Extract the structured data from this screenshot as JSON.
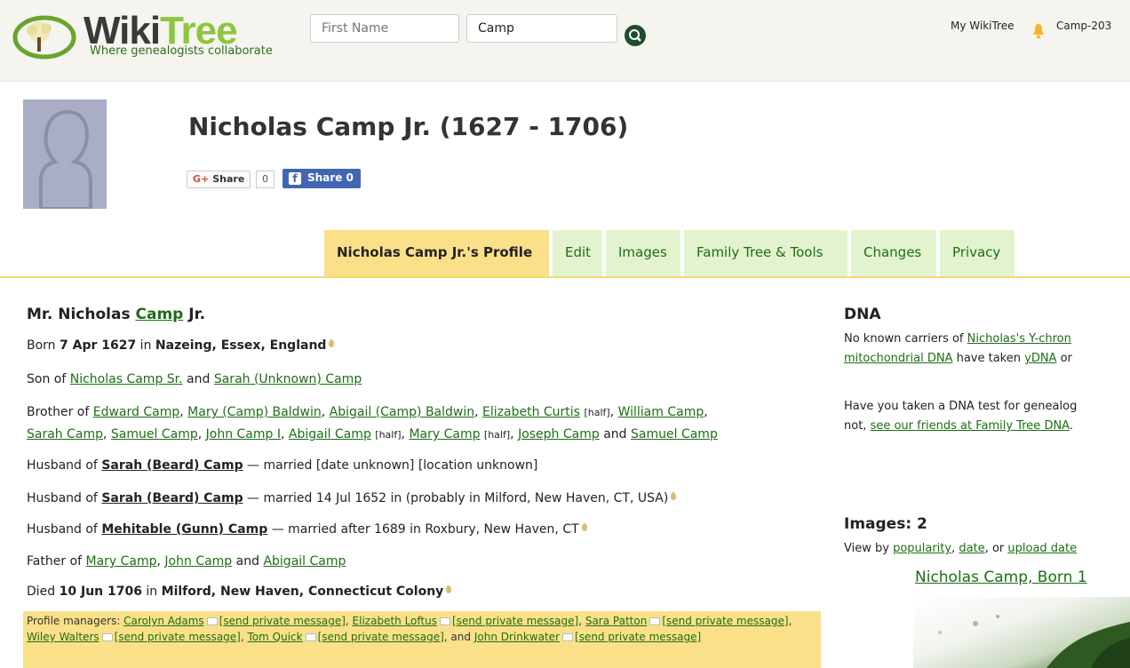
{
  "header": {
    "logo_word1": "Wiki",
    "logo_word2": "Tree",
    "tagline": "Where genealogists collaborate",
    "first_name_placeholder": "First Name",
    "last_name_value": "Camp",
    "my_wikitree": "My WikiTree",
    "user_id": "Camp-203"
  },
  "profile": {
    "title": "Nicholas Camp Jr. (1627 - 1706)",
    "gplus_label": "Share",
    "gplus_count": "0",
    "fb_label": "Share 0"
  },
  "tabs": [
    {
      "label": "Nicholas Camp Jr.'s Profile"
    },
    {
      "label": "Edit"
    },
    {
      "label": "Images"
    },
    {
      "label": "Family Tree & Tools"
    },
    {
      "label": "Changes"
    },
    {
      "label": "Privacy"
    }
  ],
  "bio": {
    "name_prefix": "Mr. Nicholas ",
    "surname": "Camp",
    "name_suffix": " Jr.",
    "born_label": "Born ",
    "born_date": "7 Apr 1627",
    "born_in": " in ",
    "born_place": "Nazeing, Essex, England",
    "son_of": "Son of ",
    "father": "Nicholas Camp Sr.",
    "and": " and ",
    "mother": "Sarah (Unknown) Camp",
    "brother_of": "Brother of ",
    "siblings_line1": [
      "Edward Camp",
      "Mary (Camp) Baldwin",
      "Abigail (Camp) Baldwin",
      "Elizabeth Curtis",
      "William Camp"
    ],
    "siblings_line2": [
      "Sarah Camp",
      "Samuel Camp",
      "John Camp I",
      "Abigail Camp",
      "Mary Camp",
      "Joseph Camp",
      "Samuel Camp"
    ],
    "half": "[half]",
    "husband_of": "Husband of ",
    "spouse1": "Sarah (Beard) Camp",
    "marriage1": " — married [date unknown] [location unknown]",
    "spouse2": "Sarah (Beard) Camp",
    "marriage2": " — married 14 Jul 1652 in (probably in Milford, New Haven, CT, USA)",
    "spouse3": "Mehitable (Gunn) Camp",
    "marriage3": " — married after 1689 in Roxbury, New Haven, CT",
    "father_of": "Father of ",
    "children": [
      "Mary Camp",
      "John Camp",
      "Abigail Camp"
    ],
    "died_label": "Died ",
    "died_date": "10 Jun 1706",
    "died_in": " in ",
    "died_place": "Milford, New Haven, Connecticut Colony"
  },
  "managers": {
    "label": "Profile managers: ",
    "people": [
      "Carolyn Adams",
      "Elizabeth Loftus",
      "Sara Patton",
      "Wiley Walters",
      "Tom Quick",
      "John Drinkwater"
    ],
    "send_pm": "[send private message]"
  },
  "dna": {
    "heading": "DNA",
    "line1_text": "No known carriers of ",
    "line1_link": "Nicholas's Y-chron",
    "line2_link1": "mitochondrial DNA",
    "line2_text": " have taken ",
    "line2_link2": "yDNA",
    "line2_tail": " or",
    "line3": "Have you taken a DNA test for genealog",
    "line4_text": "not, ",
    "line4_link": "see our friends at Family Tree DNA",
    "line4_tail": "."
  },
  "images": {
    "heading": "Images: 2",
    "view_by": "View by ",
    "popularity": "popularity",
    "date": "date",
    "or": ", or ",
    "upload_date": "upload date",
    "caption": "Nicholas Camp, Born 1"
  }
}
